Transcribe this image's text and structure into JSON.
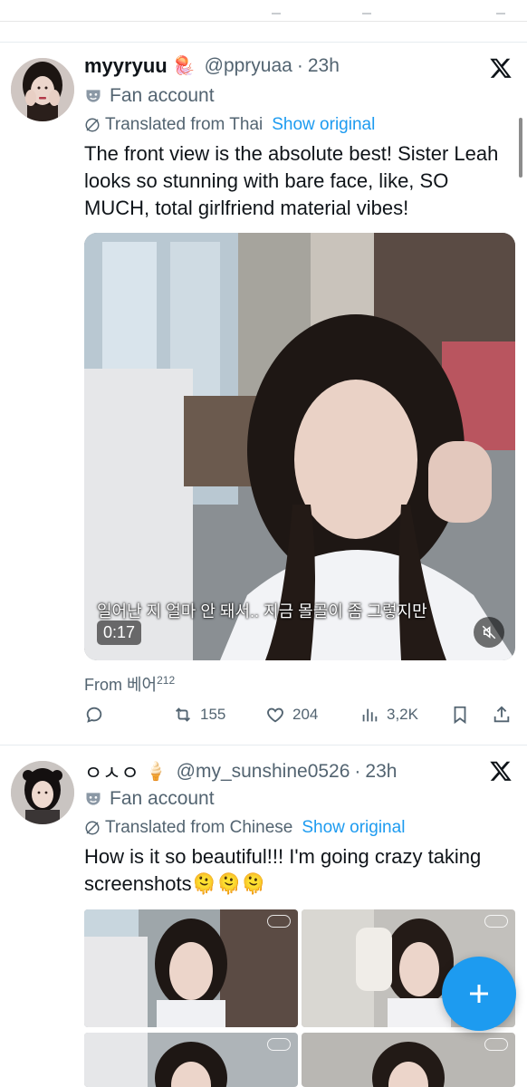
{
  "posts": [
    {
      "display_name": "myyryuu",
      "name_emoji": "🪼",
      "handle": "@ppryuaa",
      "separator": "·",
      "time": "23h",
      "badge": "Fan account",
      "translated_from": "Translated from Thai",
      "show_original": "Show original",
      "text": "The front view is the absolute best! Sister Leah looks so stunning with bare face, like, SO MUCH, total girlfriend material vibes!",
      "video": {
        "subtitle": "일어난 지 얼마 안 돼서.. 지금 몰골이 좀 그렇지만",
        "duration": "0:17"
      },
      "from_label": "From 베어",
      "from_sup": "212",
      "stats": {
        "replies": "",
        "reposts": "155",
        "likes": "204",
        "views": "3,2K"
      }
    },
    {
      "display_name": "ㅇㅅㅇ",
      "name_emoji": "🍦",
      "handle": "@my_sunshine0526",
      "separator": "·",
      "time": "23h",
      "badge": "Fan account",
      "translated_from": "Translated from Chinese",
      "show_original": "Show original",
      "text": "How is it so beautiful!!! I'm going crazy taking screenshots🫠🫠🫠",
      "image_count": 4
    }
  ],
  "icons": {
    "reply": "reply-icon",
    "repost": "repost-icon",
    "like": "heart-icon",
    "views": "views-icon",
    "bookmark": "bookmark-icon",
    "share": "share-icon",
    "compose": "plus-icon"
  },
  "colors": {
    "accent": "#1d9bf0",
    "text": "#0f1419",
    "muted": "#536471"
  }
}
